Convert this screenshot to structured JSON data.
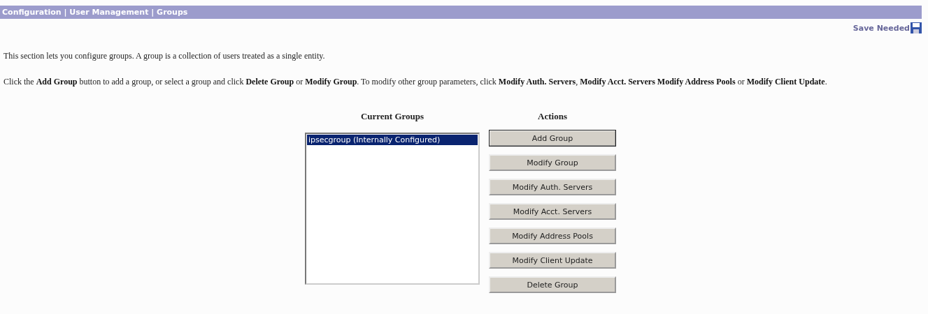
{
  "breadcrumb": "Configuration | User Management | Groups",
  "save_status": "Save Needed",
  "intro": "This section lets you configure groups. A group is a collection of users treated as a single entity.",
  "instructions": "Click the **Add Group** button to add a group, or select a group and click **Delete Group** or **Modify Group**. To modify other group parameters, click **Modify Auth. Servers**, **Modify Acct. Servers** **Modify Address Pools** or **Modify Client Update**.",
  "groups": {
    "heading": "Current Groups",
    "items": [
      {
        "label": "ipsecgroup (Internally Configured)",
        "selected": true
      }
    ]
  },
  "actions": {
    "heading": "Actions",
    "buttons": [
      {
        "label": "Add Group",
        "default": true
      },
      {
        "label": "Modify Group",
        "default": false
      },
      {
        "label": "Modify Auth. Servers",
        "default": false
      },
      {
        "label": "Modify Acct. Servers",
        "default": false
      },
      {
        "label": "Modify Address Pools",
        "default": false
      },
      {
        "label": "Modify Client Update",
        "default": false
      },
      {
        "label": "Delete Group",
        "default": false
      }
    ]
  }
}
